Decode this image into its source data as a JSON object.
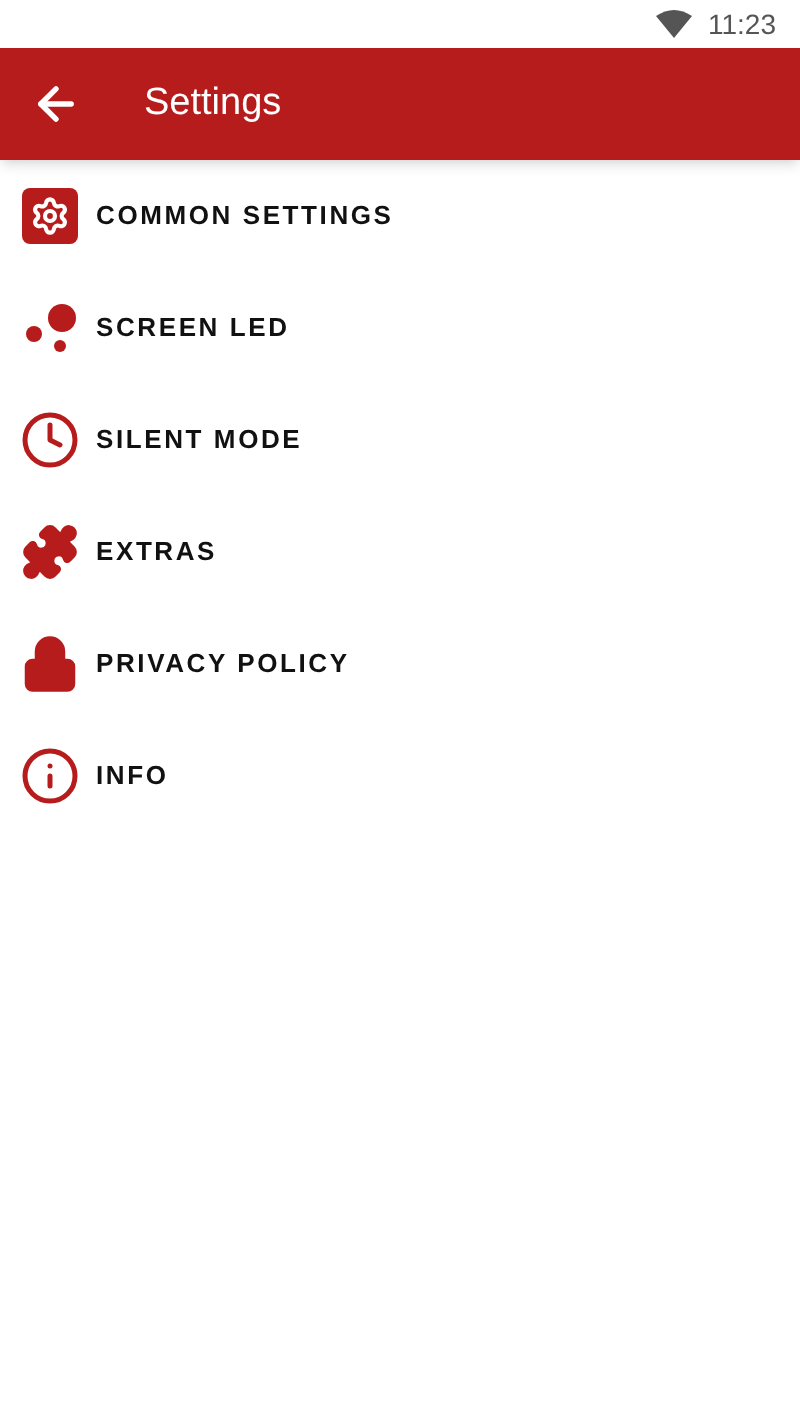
{
  "status_bar": {
    "time": "11:23"
  },
  "app_bar": {
    "title": "Settings"
  },
  "menu_items": [
    {
      "label": "COMMON SETTINGS",
      "kind": "gear"
    },
    {
      "label": "SCREEN LED",
      "kind": "dots"
    },
    {
      "label": "SILENT MODE",
      "kind": "clock"
    },
    {
      "label": "EXTRAS",
      "kind": "puzzle"
    },
    {
      "label": "PRIVACY POLICY",
      "kind": "lock"
    },
    {
      "label": "INFO",
      "kind": "info"
    }
  ]
}
